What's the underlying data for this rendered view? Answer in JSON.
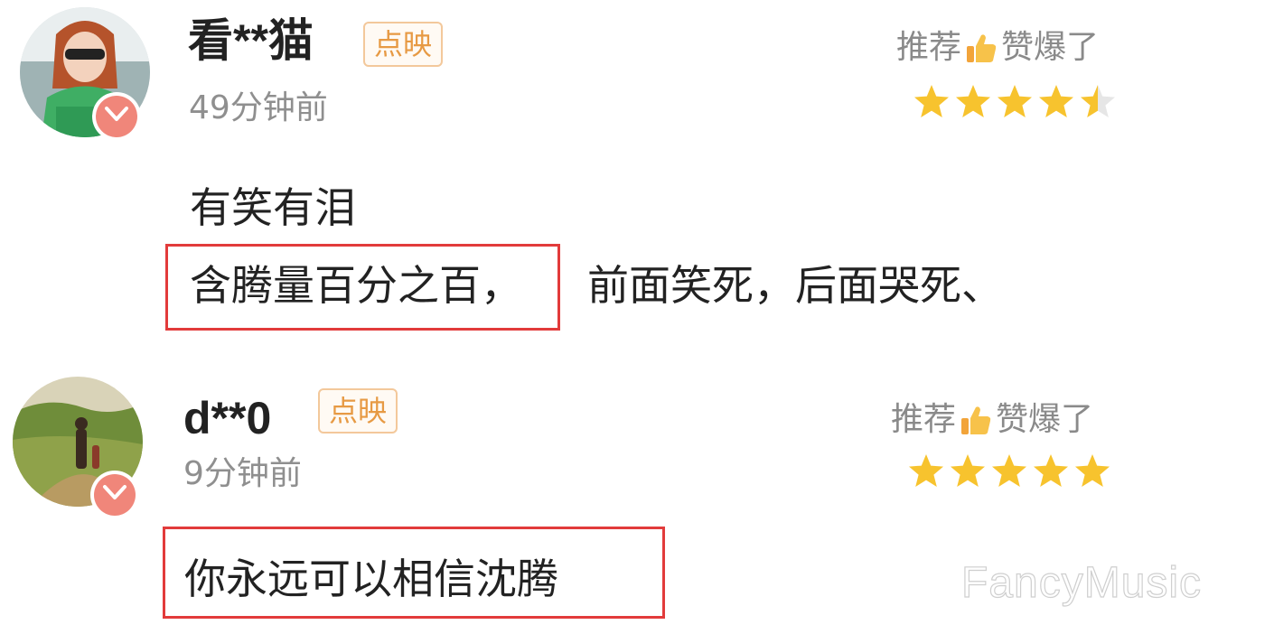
{
  "comments": [
    {
      "username": "看**猫",
      "tag": "点映",
      "time": "49分钟前",
      "rating_text_left": "推荐",
      "rating_text_right": "赞爆了",
      "rating": 4.5,
      "content": [
        "有笑有泪",
        "含腾量百分之百，",
        "前面笑死，后面哭死、"
      ]
    },
    {
      "username": "d**0",
      "tag": "点映",
      "time": "9分钟前",
      "rating_text_left": "推荐",
      "rating_text_right": "赞爆了",
      "rating": 5,
      "content": [
        "你永远可以相信沈腾"
      ]
    }
  ],
  "watermark": "FancyMusic",
  "colors": {
    "star": "#f7c32e",
    "star_empty": "#e6e6e6",
    "highlight": "#e23b3b",
    "tag_text": "#e79a44",
    "tag_border": "#f3c89b",
    "vip_badge": "#f0867a"
  }
}
